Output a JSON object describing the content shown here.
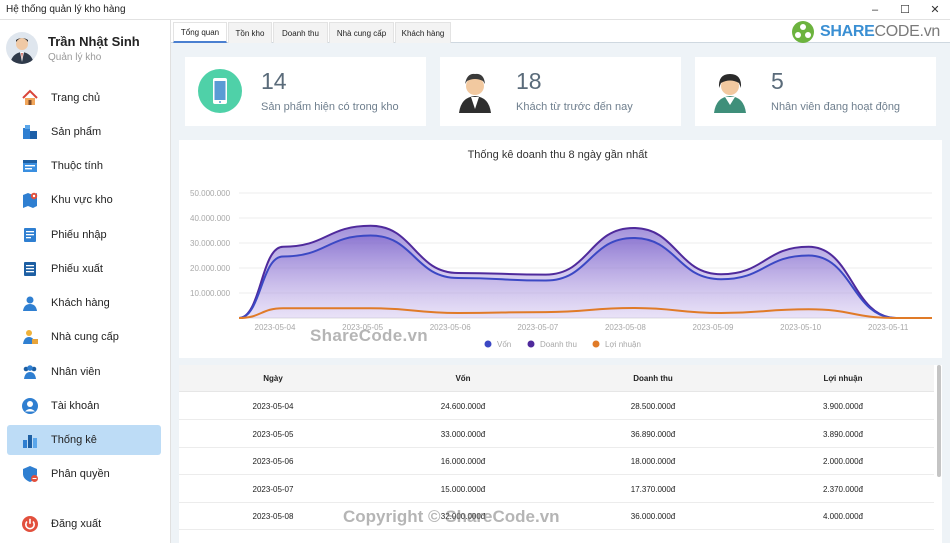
{
  "window": {
    "title": "Hệ thống quản lý kho hàng",
    "controls": [
      "–",
      "☐",
      "✕"
    ]
  },
  "user": {
    "name": "Trần Nhật Sinh",
    "role": "Quản lý kho"
  },
  "nav": [
    {
      "label": "Trang chủ",
      "icon": "home-icon"
    },
    {
      "label": "Sản phẩm",
      "icon": "product-icon"
    },
    {
      "label": "Thuộc tính",
      "icon": "attribute-icon"
    },
    {
      "label": "Khu vực kho",
      "icon": "warehouse-area-icon"
    },
    {
      "label": "Phiếu nhập",
      "icon": "import-slip-icon"
    },
    {
      "label": "Phiếu xuất",
      "icon": "export-slip-icon"
    },
    {
      "label": "Khách hàng",
      "icon": "customer-icon"
    },
    {
      "label": "Nhà cung cấp",
      "icon": "supplier-icon"
    },
    {
      "label": "Nhân viên",
      "icon": "staff-icon"
    },
    {
      "label": "Tài khoản",
      "icon": "account-icon"
    },
    {
      "label": "Thống kê",
      "icon": "statistics-icon",
      "active": true
    },
    {
      "label": "Phân quyền",
      "icon": "permission-icon"
    }
  ],
  "logout": {
    "label": "Đăng xuất",
    "icon": "power-icon"
  },
  "tabs": [
    {
      "label": "Tổng quan",
      "active": true
    },
    {
      "label": "Tồn kho"
    },
    {
      "label": "Doanh thu"
    },
    {
      "label": "Nhà cung cấp"
    },
    {
      "label": "Khách hàng"
    }
  ],
  "logo": {
    "brand": "SHARE",
    "suffix": "CODE.vn"
  },
  "stats": [
    {
      "value": "14",
      "label": "Sản phẩm hiện có trong kho",
      "icon": "phone-icon"
    },
    {
      "value": "18",
      "label": "Khách từ trước đến nay",
      "icon": "customer-avatar-icon"
    },
    {
      "value": "5",
      "label": "Nhân viên đang hoạt động",
      "icon": "employee-avatar-icon"
    }
  ],
  "chart_data": {
    "type": "area",
    "title": "Thống kê doanh thu 8 ngày gần nhất",
    "categories": [
      "2023-05-04",
      "2023-05-05",
      "2023-05-06",
      "2023-05-07",
      "2023-05-08",
      "2023-05-09",
      "2023-05-10",
      "2023-05-11"
    ],
    "y_tick_labels": [
      "10.000.000",
      "20.000.000",
      "30.000.000",
      "40.000.000",
      "50.000.000"
    ],
    "ylim": [
      0,
      50000000
    ],
    "grid": true,
    "legend_position": "bottom",
    "series": [
      {
        "name": "Vốn",
        "color": "#3b48c4",
        "values": [
          24600000,
          33000000,
          16000000,
          15000000,
          32000000,
          15500000,
          25000000,
          0
        ]
      },
      {
        "name": "Doanh thu",
        "color": "#4f2a9c",
        "values": [
          28500000,
          36890000,
          18000000,
          17370000,
          36000000,
          17500000,
          28500000,
          0
        ]
      },
      {
        "name": "Lợi nhuận",
        "color": "#e07b28",
        "values": [
          3900000,
          3890000,
          2000000,
          2370000,
          4000000,
          2000000,
          3500000,
          0
        ]
      }
    ]
  },
  "table": {
    "headers": [
      "Ngày",
      "Vốn",
      "Doanh thu",
      "Lợi nhuận"
    ],
    "rows": [
      [
        "2023-05-04",
        "24.600.000đ",
        "28.500.000đ",
        "3.900.000đ"
      ],
      [
        "2023-05-05",
        "33.000.000đ",
        "36.890.000đ",
        "3.890.000đ"
      ],
      [
        "2023-05-06",
        "16.000.000đ",
        "18.000.000đ",
        "2.000.000đ"
      ],
      [
        "2023-05-07",
        "15.000.000đ",
        "17.370.000đ",
        "2.370.000đ"
      ],
      [
        "2023-05-08",
        "32.000.000đ",
        "36.000.000đ",
        "4.000.000đ"
      ]
    ]
  },
  "watermarks": {
    "center": "ShareCode.vn",
    "bottom": "Copyright © ShareCode.vn"
  }
}
